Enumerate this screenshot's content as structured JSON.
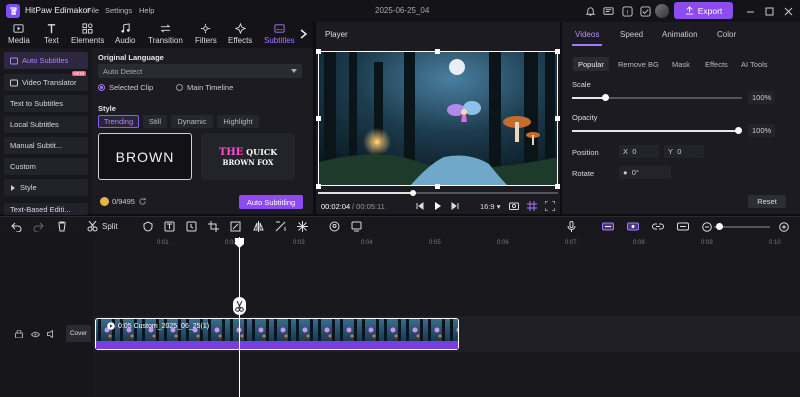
{
  "app": {
    "name": "HitPaw Edimakor",
    "doc_title": "2025-06-25_04",
    "export_label": "Export"
  },
  "menu": [
    "File",
    "Settings",
    "Help"
  ],
  "tool_tabs": [
    {
      "label": "Media",
      "icon": "media-icon"
    },
    {
      "label": "Text",
      "icon": "text-icon"
    },
    {
      "label": "Elements",
      "icon": "elements-icon"
    },
    {
      "label": "Audio",
      "icon": "audio-icon"
    },
    {
      "label": "Transition",
      "icon": "transition-icon"
    },
    {
      "label": "Filters",
      "icon": "filters-icon"
    },
    {
      "label": "Effects",
      "icon": "effects-icon"
    },
    {
      "label": "Subtitles",
      "icon": "subtitles-icon",
      "active": true
    }
  ],
  "subtitle_nav": [
    {
      "label": "Auto Subtitles",
      "active": true
    },
    {
      "label": "Video Translator",
      "badge": "NEW"
    },
    {
      "label": "Text to Subtitles"
    },
    {
      "label": "Local Subtitles"
    },
    {
      "label": "Manual Subtit..."
    },
    {
      "label": "Custom"
    },
    {
      "label": "Style"
    },
    {
      "label": "Text-Based Editi..."
    }
  ],
  "subtitle_panel": {
    "original_language_label": "Original Language",
    "language_value": "Auto Detect",
    "radio_selected_clip": "Selected Clip",
    "radio_main_timeline": "Main Timeline",
    "style_label": "Style",
    "style_tabs": [
      "Trending",
      "Still",
      "Dynamic",
      "Highlight"
    ],
    "style_card1_text": "BROWN",
    "style_card2_line1_a": "THE",
    "style_card2_line1_b": "QUICK",
    "style_card2_line2": "BROWN FOX",
    "credits": "0/9495",
    "auto_button": "Auto Subtitling"
  },
  "player": {
    "title": "Player",
    "time_current": "00:02:04",
    "time_total": "/ 00:05:11",
    "ratio": "16:9",
    "progress": 0.4
  },
  "props": {
    "tabs": [
      "Videos",
      "Speed",
      "Animation",
      "Color"
    ],
    "subtabs": [
      "Popular",
      "Remove BG",
      "Mask",
      "Effects",
      "AI Tools"
    ],
    "scale_label": "Scale",
    "scale_value": "100%",
    "opacity_label": "Opacity",
    "opacity_value": "100%",
    "position_label": "Position",
    "pos_x_label": "X",
    "pos_x": "0",
    "pos_y_label": "Y",
    "pos_y": "0",
    "rotate_label": "Rotate",
    "rotate_value": "0°",
    "reset_label": "Reset"
  },
  "toolbar": {
    "split_label": "Split"
  },
  "timeline": {
    "ruler": [
      "0:01",
      "0:02",
      "0:03",
      "0:04",
      "0:05",
      "0:06",
      "0:07",
      "0:08",
      "0:09",
      "0:10"
    ],
    "clip_label": "0:05 Custom_2025_06_25(1)",
    "cover_label": "Cover",
    "playhead_time": 0.0208
  },
  "colors": {
    "accent": "#8e4bf0",
    "accent_light": "#a779ff",
    "bg": "#0d0d11"
  }
}
